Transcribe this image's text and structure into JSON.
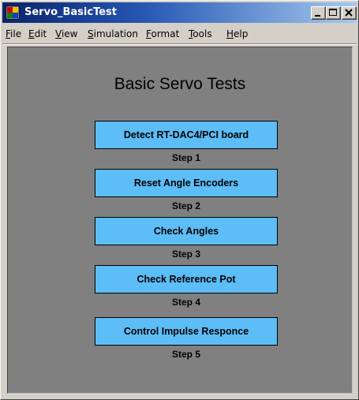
{
  "window": {
    "title": "Servo_BasicTest",
    "icon": "simulink-model-icon",
    "controls": [
      "minimize-icon",
      "maximize-icon",
      "close-icon"
    ]
  },
  "menu": {
    "items": [
      "File",
      "Edit",
      "View",
      "Simulation",
      "Format",
      "Tools",
      "Help"
    ]
  },
  "canvas": {
    "title": "Basic Servo Tests",
    "background": "#808080",
    "block_color": "#5cbdf7",
    "blocks": [
      {
        "label": "Detect RT-DAC4/PCI board",
        "step": "Step 1"
      },
      {
        "label": "Reset Angle Encoders",
        "step": "Step 2"
      },
      {
        "label": "Check Angles",
        "step": "Step 3"
      },
      {
        "label": "Check Reference Pot",
        "step": "Step 4"
      },
      {
        "label": "Control Impulse Responce",
        "step": "Step 5"
      }
    ]
  }
}
